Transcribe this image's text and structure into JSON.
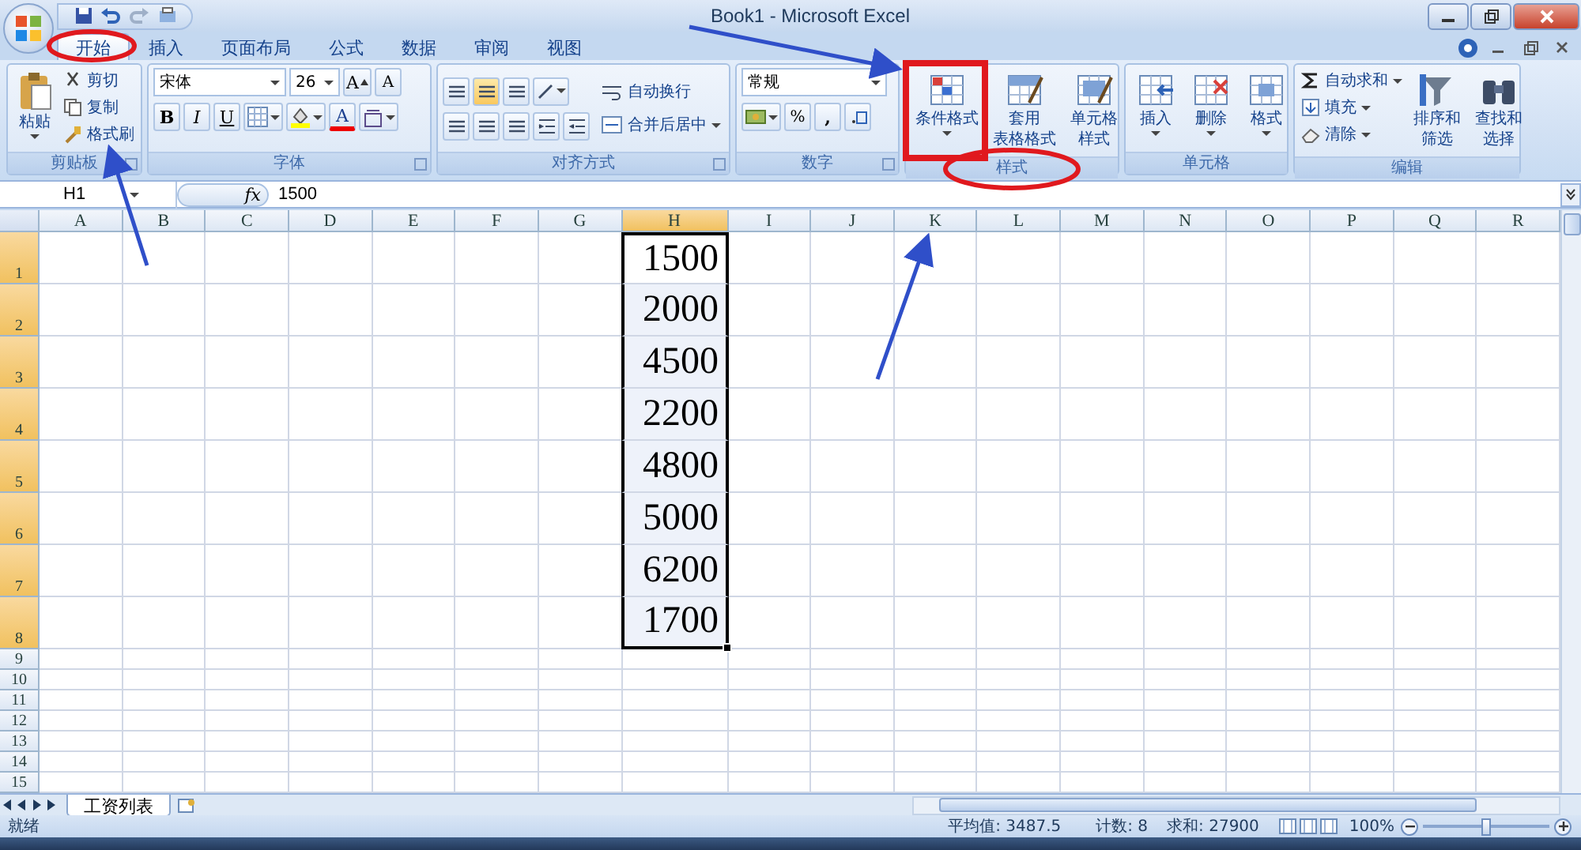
{
  "title_bar": {
    "title": "Book1 - Microsoft Excel"
  },
  "tabs": [
    {
      "label": "开始",
      "selected": true
    },
    {
      "label": "插入",
      "selected": false
    },
    {
      "label": "页面布局",
      "selected": false
    },
    {
      "label": "公式",
      "selected": false
    },
    {
      "label": "数据",
      "selected": false
    },
    {
      "label": "审阅",
      "selected": false
    },
    {
      "label": "视图",
      "selected": false
    }
  ],
  "ribbon": [
    {
      "kind": "clipboard",
      "label": "剪贴板",
      "paste": "粘贴",
      "items": [
        "剪切",
        "复制",
        "格式刷"
      ]
    },
    {
      "kind": "font",
      "label": "字体",
      "font": "宋体",
      "size": "26",
      "grow": "A",
      "shrink": "A",
      "styles": [
        "B",
        "I",
        "U"
      ],
      "font_color_label": "A"
    },
    {
      "kind": "alignment",
      "label": "对齐方式",
      "items": [
        "自动换行",
        "合并后居中"
      ]
    },
    {
      "kind": "number",
      "label": "数字",
      "format": "常规",
      "percent": "%",
      "comma": ","
    },
    {
      "kind": "styles",
      "label": "样式",
      "buttons": [
        {
          "lines": [
            "条件格式"
          ]
        },
        {
          "lines": [
            "套用",
            "表格格式"
          ]
        },
        {
          "lines": [
            "单元格",
            "样式"
          ]
        }
      ]
    },
    {
      "kind": "cells",
      "label": "单元格",
      "buttons": [
        {
          "lines": [
            "插入"
          ]
        },
        {
          "lines": [
            "删除"
          ]
        },
        {
          "lines": [
            "格式"
          ]
        }
      ]
    },
    {
      "kind": "editing",
      "label": "编辑",
      "items": [
        "自动求和",
        "填充",
        "清除"
      ],
      "buttons": [
        {
          "lines": [
            "排序和",
            "筛选"
          ]
        },
        {
          "lines": [
            "查找和",
            "选择"
          ]
        }
      ]
    }
  ],
  "formula_bar": {
    "name_box": "H1",
    "function_label": "fx",
    "formula": "1500"
  },
  "sheet": {
    "columns": [
      {
        "label": "A",
        "selected": false
      },
      {
        "label": "B",
        "selected": false
      },
      {
        "label": "C",
        "selected": false
      },
      {
        "label": "D",
        "selected": false
      },
      {
        "label": "E",
        "selected": false
      },
      {
        "label": "F",
        "selected": false
      },
      {
        "label": "G",
        "selected": false
      },
      {
        "label": "H",
        "selected": true
      },
      {
        "label": "I",
        "selected": false
      },
      {
        "label": "J",
        "selected": false
      },
      {
        "label": "K",
        "selected": false
      },
      {
        "label": "L",
        "selected": false
      },
      {
        "label": "M",
        "selected": false
      },
      {
        "label": "N",
        "selected": false
      },
      {
        "label": "O",
        "selected": false
      },
      {
        "label": "P",
        "selected": false
      },
      {
        "label": "Q",
        "selected": false
      },
      {
        "label": "R",
        "selected": false
      }
    ],
    "rows": [
      {
        "header": "1",
        "selected": true,
        "tall": true,
        "cells": {
          "H": "1500"
        }
      },
      {
        "header": "2",
        "selected": true,
        "tall": true,
        "cells": {
          "H": "2000"
        }
      },
      {
        "header": "3",
        "selected": true,
        "tall": true,
        "cells": {
          "H": "4500"
        }
      },
      {
        "header": "4",
        "selected": true,
        "tall": true,
        "cells": {
          "H": "2200"
        }
      },
      {
        "header": "5",
        "selected": true,
        "tall": true,
        "cells": {
          "H": "4800"
        }
      },
      {
        "header": "6",
        "selected": true,
        "tall": true,
        "cells": {
          "H": "5000"
        }
      },
      {
        "header": "7",
        "selected": true,
        "tall": true,
        "cells": {
          "H": "6200"
        }
      },
      {
        "header": "8",
        "selected": true,
        "tall": true,
        "cells": {
          "H": "1700"
        }
      },
      {
        "header": "9",
        "selected": false,
        "tall": false
      },
      {
        "header": "10",
        "selected": false,
        "tall": false
      },
      {
        "header": "11",
        "selected": false,
        "tall": false
      },
      {
        "header": "12",
        "selected": false,
        "tall": false
      },
      {
        "header": "13",
        "selected": false,
        "tall": false
      },
      {
        "header": "14",
        "selected": false,
        "tall": false
      },
      {
        "header": "15",
        "selected": false,
        "tall": false
      }
    ]
  },
  "sheet_tabs": [
    {
      "label": "工资列表",
      "selected": true
    }
  ],
  "status_bar": {
    "mode": "就绪",
    "average": "平均值: 3487.5",
    "count": "计数: 8",
    "sum": "求和: 27900",
    "zoom": "100%",
    "zoom_slider": {
      "level": 0.5
    }
  }
}
